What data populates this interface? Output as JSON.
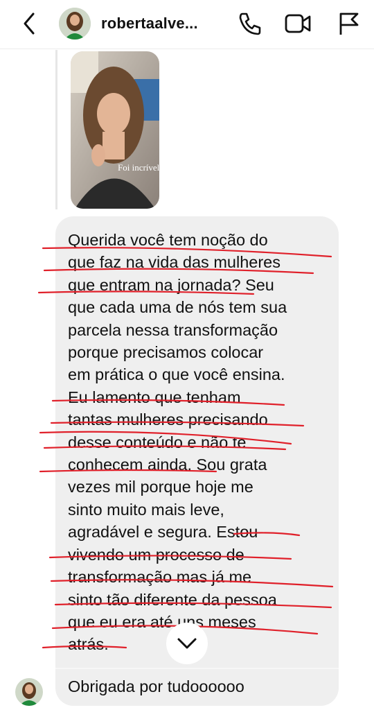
{
  "header": {
    "username": "robertaalve...",
    "icons": [
      "back-icon",
      "phone-icon",
      "video-camera-icon",
      "flag-icon"
    ]
  },
  "story": {
    "caption": "Foi incrível."
  },
  "message": {
    "lines": [
      "Querida você tem noção do",
      "que faz na vida das mulheres",
      "que entram na jornada?  Seu",
      "que cada uma de nós tem sua",
      "parcela nessa transformação",
      "porque precisamos colocar",
      "em prática o que você ensina.",
      "Eu lamento que tenham",
      "tantas mulheres precisando",
      "desse conteúdo e não te",
      "conhecem ainda.  Sou grata",
      "vezes mil porque hoje me",
      "sinto muito mais leve,",
      "agradável e segura.  Estou",
      "vivendo um processo de",
      "transformação mas já me",
      "sinto tão diferente da pessoa",
      "que eu era até uns meses",
      "atrás."
    ],
    "highlight_color": "#e0202a"
  },
  "second_message": {
    "text": "Obrigada por tudoooooo"
  },
  "colors": {
    "bubble": "#efefef",
    "text": "#111111",
    "accent_green": "#1f8a3b"
  }
}
